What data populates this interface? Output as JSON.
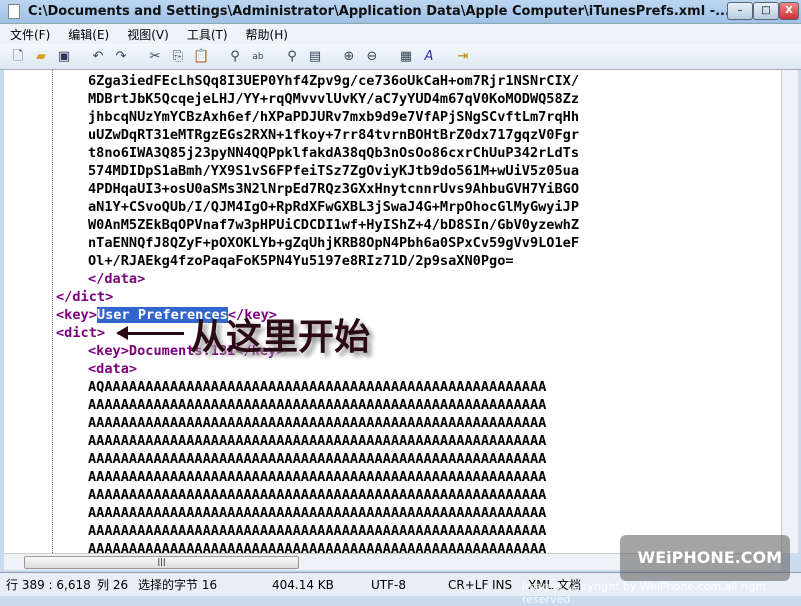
{
  "window": {
    "title": "C:\\Documents and Settings\\Administrator\\Application Data\\Apple Computer\\iTunesPrefs.xml -...",
    "minimize": "–",
    "maximize": "□",
    "close": "X"
  },
  "menu": [
    "文件(F)",
    "编辑(E)",
    "视图(V)",
    "工具(T)",
    "帮助(H)"
  ],
  "toolbar": [
    "new-icon",
    "open-icon",
    "save-icon",
    "undo-icon",
    "redo-icon",
    "cut-icon",
    "copy-icon",
    "paste-icon",
    "find-icon",
    "replace-icon",
    "goto-icon",
    "insert-icon",
    "zoom-in-icon",
    "zoom-out-icon",
    "view-icon",
    "font-icon",
    "exit-icon"
  ],
  "editor": {
    "base64_lines": [
      "6Zga3iedFEcLhSQq8I3UEP0Yhf4Zpv9g/ce736oUkCaH+om7Rjr1NSNrCIX/",
      "MDBrtJbK5QcqejeLHJ/YY+rqQMvvvlUvKY/aC7yYUD4m67qV0KoMODWQ58Zz",
      "jhbcqNUzYmYCBzAxh6ef/hXPaPDJURv7mxb9d9e7VfAPjSNgSCvftLm7rqHh",
      "uUZwDqRT31eMTRgzEGs2RXN+1fkoy+7rr84tvrnBOHtBrZ0dx717gqzV0Fgr",
      "t8no6IWA3Q85j23pyNN4QQPpklfakdA38qQb3nOsOo86cxrChUuP342rLdTs",
      "574MDIDpS1aBmh/YX9S1vS6FPfeiTSz7ZgOviyKJtb9do561M+wUiV5z05ua",
      "4PDHqaUI3+osU0aSMs3N2lNrpEd7RQz3GXxHnytcnnrUvs9AhbuGVH7YiBGO",
      "aN1Y+CSvoQUb/I/QJM4IgO+RpRdXFwGXBL3jSwaJ4G+MrpOhocGlMyGwyiJP",
      "W0AnM5ZEkBqOPVnaf7w3pHPUiCDCDI1wf+HyIShZ+4/bD8SIn/GbV0yzewhZ",
      "nTaENNQfJ8QZyF+pOXOKLYb+gZqUhjKRB8OpN4Pbh6a0SPxCv59gVv9LO1eF",
      "Ol+/RJAEkg4fzoPaqaFoK5PN4Yu5197e8RIz71D/2p9saXN0Pgo="
    ],
    "data_close": "</data>",
    "dict_close": "</dict>",
    "key_open": "<key>",
    "key_text": "User Preferences",
    "key_close": "</key>",
    "dict_open": "<dict>",
    "documents_key": "<key>Documents:131</key>",
    "data_open": "<data>",
    "a_lines": [
      "AQAAAAAAAAAAAAAAAAAAAAAAAAAAAAAAAAAAAAAAAAAAAAAAAAAAAAAA",
      "AAAAAAAAAAAAAAAAAAAAAAAAAAAAAAAAAAAAAAAAAAAAAAAAAAAAAAAA",
      "AAAAAAAAAAAAAAAAAAAAAAAAAAAAAAAAAAAAAAAAAAAAAAAAAAAAAAAA",
      "AAAAAAAAAAAAAAAAAAAAAAAAAAAAAAAAAAAAAAAAAAAAAAAAAAAAAAAA",
      "AAAAAAAAAAAAAAAAAAAAAAAAAAAAAAAAAAAAAAAAAAAAAAAAAAAAAAAA",
      "AAAAAAAAAAAAAAAAAAAAAAAAAAAAAAAAAAAAAAAAAAAAAAAAAAAAAAAA",
      "AAAAAAAAAAAAAAAAAAAAAAAAAAAAAAAAAAAAAAAAAAAAAAAAAAAAAAAA",
      "AAAAAAAAAAAAAAAAAAAAAAAAAAAAAAAAAAAAAAAAAAAAAAAAAAAAAAAA",
      "AAAAAAAAAAAAAAAAAAAAAAAAAAAAAAAAAAAAAAAAAAAAAAAAAAAAAAAA",
      "AAAAAAAAAAAAAAAAAAAAAAAAAAAAAAAAAAAAAAAAAAAAAAAAAAAAAAAA"
    ]
  },
  "annotation": "从这里开始",
  "status": {
    "position": "行 389 : 6,618",
    "column": "列 26",
    "selected": "选择的字节 16",
    "size": "404.14 KB",
    "encoding": "UTF-8",
    "line_ending": "CR+LF",
    "mode": "INS",
    "type": "XML 文档"
  },
  "watermark": {
    "logo": "WEiPHONE.COM",
    "copyright": "Images Copyright by WeiPhone.com,all right reserved"
  },
  "scroll_grip": "|||"
}
